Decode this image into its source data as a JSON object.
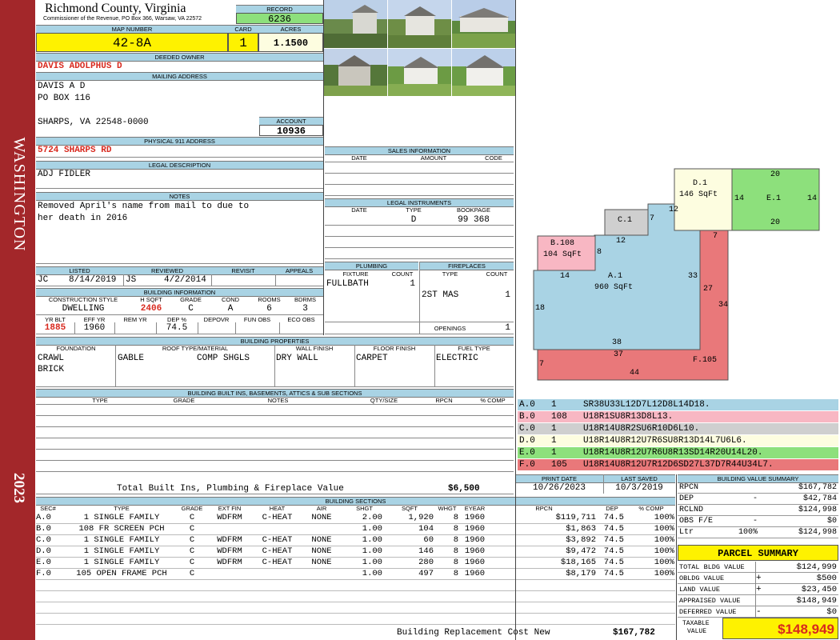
{
  "sidebar": {
    "county": "WASHINGTON",
    "year": "2023",
    "color": "#a3272a"
  },
  "header": {
    "title": "Richmond County, Virginia",
    "subtitle": "Commissioner of the Revenue, PO Box 366, Warsaw, VA 22572",
    "record_label": "RECORD",
    "record": "6236"
  },
  "parcel": {
    "map_label": "MAP NUMBER",
    "map_number": "42-8A",
    "card_label": "CARD",
    "card": "1",
    "acres_label": "ACRES",
    "acres": "1.1500"
  },
  "owner": {
    "deeded_label": "DEEDED OWNER",
    "deeded": "DAVIS ADOLPHUS D",
    "mailing_label": "MAILING ADDRESS",
    "mail_1": "DAVIS A D",
    "mail_2": "PO BOX 116",
    "mail_3": "SHARPS, VA 22548-0000",
    "account_label": "ACCOUNT",
    "account": "10936"
  },
  "address": {
    "label": "PHYSICAL 911 ADDRESS",
    "value": "5724 SHARPS RD"
  },
  "legal": {
    "label": "LEGAL DESCRIPTION",
    "value": "ADJ FIDLER"
  },
  "notes": {
    "label": "NOTES",
    "line1": "Removed April's name from mail to due to",
    "line2": "her death in 2016"
  },
  "listing": {
    "listed_label": "LISTED",
    "reviewed_label": "REVIEWED",
    "revisit_label": "REVISIT",
    "appeals_label": "APPEALS",
    "listed_by": "JC",
    "listed_date": "8/14/2019",
    "reviewed_by": "JS",
    "reviewed_date": "4/2/2014"
  },
  "building_info": {
    "label": "BUILDING INFORMATION",
    "h_style": "CONSTRUCTION STYLE",
    "h_sqft": "H SQFT",
    "h_grade": "GRADE",
    "h_cond": "COND",
    "h_rooms": "ROOMS",
    "h_bdrms": "BDRMS",
    "style": "DWELLING",
    "sqft": "2406",
    "grade": "C",
    "cond": "A",
    "rooms": "6",
    "bdrms": "3",
    "h_yrblt": "YR BLT",
    "h_effyr": "EFF YR",
    "h_remyr": "REM YR",
    "h_dep": "DEP %",
    "h_depovr": "DEPOVR",
    "h_funobs": "FUN OBS",
    "h_ecoobs": "ECO OBS",
    "yr_blt": "1885",
    "eff_yr": "1960",
    "dep": "74.5"
  },
  "sales": {
    "label": "SALES INFORMATION",
    "h_date": "DATE",
    "h_amount": "AMOUNT",
    "h_code": "CODE"
  },
  "legal_instruments": {
    "label": "LEGAL INSTRUMENTS",
    "h_date": "DATE",
    "h_type": "TYPE",
    "h_bookpage": "BOOKPAGE",
    "type": "D",
    "bookpage": "99 368"
  },
  "plumbing": {
    "label": "PLUMBING",
    "h_fixture": "FIXTURE",
    "h_count": "COUNT",
    "fixture": "FULLBATH",
    "count": "1"
  },
  "fireplaces": {
    "label": "FIREPLACES",
    "h_type": "TYPE",
    "h_count": "COUNT",
    "type": "2ST MAS",
    "count": "1",
    "openings_label": "OPENINGS",
    "openings": "1"
  },
  "properties": {
    "label": "BUILDING PROPERTIES",
    "h_foundation": "FOUNDATION",
    "h_roof": "ROOF TYPE/MATERIAL",
    "h_wall": "WALL FINISH",
    "h_floor": "FLOOR FINISH",
    "h_fuel": "FUEL TYPE",
    "foundation1": "CRAWL",
    "foundation2": "BRICK",
    "roof_type": "GABLE",
    "roof_mat": "COMP SHGLS",
    "wall": "DRY WALL",
    "floor": "CARPET",
    "fuel": "ELECTRIC"
  },
  "builtins": {
    "label": "BUILDING BUILT INS, BASEMENTS, ATTICS & SUB SECTIONS",
    "h_type": "TYPE",
    "h_grade": "GRADE",
    "h_notes": "NOTES",
    "h_qty": "QTY/SIZE",
    "h_rpcn": "RPCN",
    "h_comp": "% COMP",
    "total_label": "Total Built Ins, Plumbing & Fireplace Value",
    "total": "$6,500"
  },
  "sketch": {
    "labels": [
      {
        "name": "A.1",
        "area": "960 SqFt"
      },
      {
        "name": "B.108",
        "area": "104 SqFt"
      },
      {
        "name": "C.1",
        "area": ""
      },
      {
        "name": "D.1",
        "area": "146 SqFt"
      },
      {
        "name": "E.1",
        "area": ""
      },
      {
        "name": "F.105",
        "area": ""
      }
    ],
    "dims": [
      "14",
      "8",
      "12",
      "7",
      "12",
      "33",
      "18",
      "38",
      "7",
      "27",
      "34",
      "37",
      "44",
      "7",
      "20",
      "14",
      "14",
      "20"
    ],
    "colors": {
      "A": "#a9d3e4",
      "B": "#f8b7c3",
      "C": "#cfcfcf",
      "D": "#fdfde0",
      "E": "#8de07c",
      "F": "#e9787a"
    }
  },
  "sections": [
    {
      "id": "A.0",
      "num": "1",
      "code": "SR38U33L12D7L12D8L14D18.",
      "color": "#a9d3e4"
    },
    {
      "id": "B.0",
      "num": "108",
      "code": "U18R1SU8R13D8L13.",
      "color": "#f8b7c3"
    },
    {
      "id": "C.0",
      "num": "1",
      "code": "U18R14U8R2SU6R10D6L10.",
      "color": "#cfcfcf"
    },
    {
      "id": "D.0",
      "num": "1",
      "code": "U18R14U8R12U7R6SU8R13D14L7U6L6.",
      "color": "#fdfde0"
    },
    {
      "id": "E.0",
      "num": "1",
      "code": "U18R14U8R12U7R6U8R13SD14R20U14L20.",
      "color": "#8de07c"
    },
    {
      "id": "F.0",
      "num": "105",
      "code": "U18R14U8R12U7R12D6SD27L37D7R44U34L7.",
      "color": "#e9787a"
    }
  ],
  "dates": {
    "print_label": "PRINT DATE",
    "print": "10/26/2023",
    "saved_label": "LAST SAVED",
    "saved": "10/3/2019"
  },
  "building_sections": {
    "label": "BUILDING SECTIONS",
    "headers": [
      "SEC#",
      "TYPE",
      "GRADE",
      "EXT FIN",
      "HEAT",
      "AIR",
      "SHGT",
      "SQFT",
      "WHGT",
      "EYEAR",
      "RPCN",
      "DEP",
      "% COMP"
    ],
    "rows": [
      [
        "A.0",
        "1 SINGLE FAMILY",
        "C",
        "WDFRM",
        "C-HEAT",
        "NONE",
        "2.00",
        "1,920",
        "8",
        "1960",
        "$119,711",
        "74.5",
        "100%"
      ],
      [
        "B.0",
        "108 FR SCREEN PCH",
        "C",
        "",
        "",
        "",
        "1.00",
        "104",
        "8",
        "1960",
        "$1,863",
        "74.5",
        "100%"
      ],
      [
        "C.0",
        "1 SINGLE FAMILY",
        "C",
        "WDFRM",
        "C-HEAT",
        "NONE",
        "1.00",
        "60",
        "8",
        "1960",
        "$3,892",
        "74.5",
        "100%"
      ],
      [
        "D.0",
        "1 SINGLE FAMILY",
        "C",
        "WDFRM",
        "C-HEAT",
        "NONE",
        "1.00",
        "146",
        "8",
        "1960",
        "$9,472",
        "74.5",
        "100%"
      ],
      [
        "E.0",
        "1 SINGLE FAMILY",
        "C",
        "WDFRM",
        "C-HEAT",
        "NONE",
        "1.00",
        "280",
        "8",
        "1960",
        "$18,165",
        "74.5",
        "100%"
      ],
      [
        "F.0",
        "105 OPEN FRAME PCH",
        "C",
        "",
        "",
        "",
        "1.00",
        "497",
        "8",
        "1960",
        "$8,179",
        "74.5",
        "100%"
      ]
    ],
    "replacement_label": "Building Replacement Cost New",
    "replacement": "$167,782"
  },
  "value_summary": {
    "label": "BUILDING VALUE SUMMARY",
    "rows": [
      {
        "k": "RPCN",
        "op": "",
        "v": "$167,782"
      },
      {
        "k": "DEP",
        "op": "-",
        "v": "$42,784"
      },
      {
        "k": "RCLND",
        "op": "",
        "v": "$124,998"
      },
      {
        "k": "OBS F/E",
        "op": "-",
        "v": "$0"
      },
      {
        "k": "Ltr",
        "op": "100%",
        "v": "$124,998"
      }
    ]
  },
  "parcel_summary": {
    "label": "PARCEL SUMMARY",
    "rows": [
      {
        "k": "TOTAL BLDG VALUE",
        "op": "",
        "v": "$124,999"
      },
      {
        "k": "OBLDG VALUE",
        "op": "+",
        "v": "$500"
      },
      {
        "k": "LAND VALUE",
        "op": "+",
        "v": "$23,450"
      },
      {
        "k": "APPRAISED VALUE",
        "op": "",
        "v": "$148,949"
      },
      {
        "k": "DEFERRED VALUE",
        "op": "-",
        "v": "$0"
      }
    ],
    "taxable_label1": "TAXABLE",
    "taxable_label2": "VALUE",
    "taxable": "$148,949"
  }
}
